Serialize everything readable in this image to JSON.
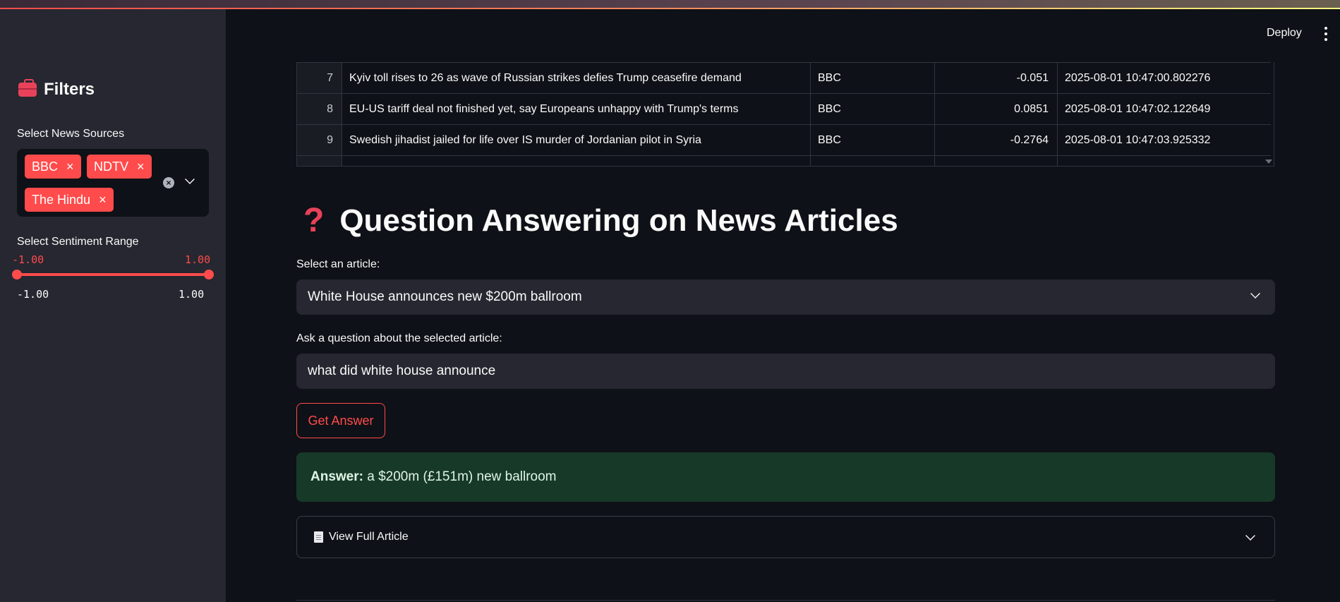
{
  "header": {
    "deploy_label": "Deploy"
  },
  "sidebar": {
    "title": "Filters",
    "sources_label": "Select News Sources",
    "selected_sources": [
      "BBC",
      "NDTV",
      "The Hindu"
    ],
    "sentiment_label": "Select Sentiment Range",
    "slider_values": {
      "min": "-1.00",
      "max": "1.00"
    },
    "slider_range": {
      "min": "-1.00",
      "max": "1.00"
    },
    "accent_color": "#ff4b4b"
  },
  "table": {
    "rows": [
      {
        "idx": "7",
        "title": "Kyiv toll rises to 26 as wave of Russian strikes defies Trump ceasefire demand",
        "source": "BBC",
        "sentiment": "-0.051",
        "time": "2025-08-01 10:47:00.802276"
      },
      {
        "idx": "8",
        "title": "EU-US tariff deal not finished yet, say Europeans unhappy with Trump's terms",
        "source": "BBC",
        "sentiment": "0.0851",
        "time": "2025-08-01 10:47:02.122649"
      },
      {
        "idx": "9",
        "title": "Swedish jihadist jailed for life over IS murder of Jordanian pilot in Syria",
        "source": "BBC",
        "sentiment": "-0.2764",
        "time": "2025-08-01 10:47:03.925332"
      }
    ]
  },
  "qa": {
    "heading": "Question Answering on News Articles",
    "select_label": "Select an article:",
    "selected_article": "White House announces new $200m ballroom",
    "question_label": "Ask a question about the selected article:",
    "question_value": "what did white house announce",
    "button_label": "Get Answer",
    "answer_prefix": "Answer:",
    "answer_text": "a $200m (£151m) new ballroom",
    "expander_label": "View Full Article"
  }
}
